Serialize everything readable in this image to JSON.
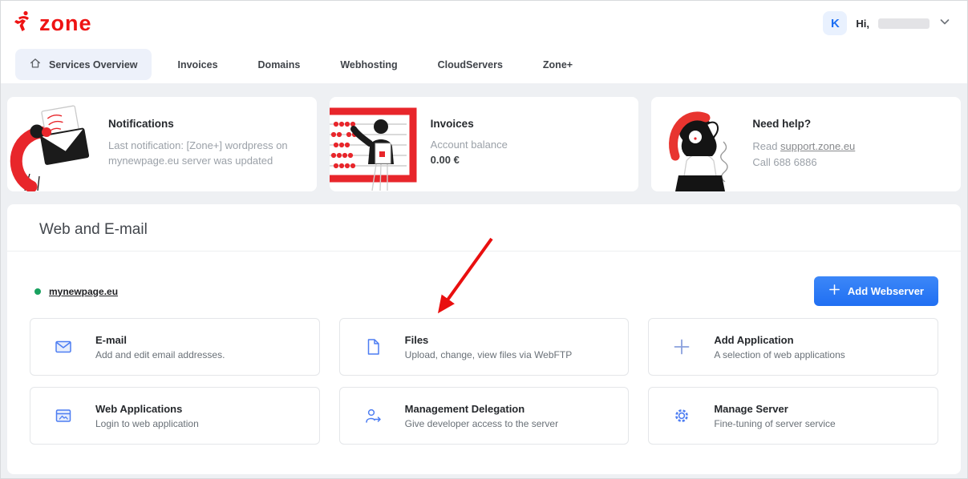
{
  "colors": {
    "brand_red": "#ee1313",
    "accent_blue": "#2374f2",
    "icon_blue": "#4d7df2",
    "status_green": "#18a15f",
    "arrow_red": "#e90f0f"
  },
  "header": {
    "logo_text": "zone",
    "user": {
      "avatar_initial": "K",
      "greeting": "Hi,"
    }
  },
  "nav": {
    "items": [
      {
        "label": "Services Overview",
        "active": true
      },
      {
        "label": "Invoices"
      },
      {
        "label": "Domains"
      },
      {
        "label": "Webhosting"
      },
      {
        "label": "CloudServers"
      },
      {
        "label": "Zone+"
      }
    ]
  },
  "info_cards": {
    "notifications": {
      "title": "Notifications",
      "desc": "Last notification: [Zone+] wordpress on mynewpage.eu server was updated"
    },
    "invoices": {
      "title": "Invoices",
      "balance_label": "Account balance",
      "balance_value": "0.00 €"
    },
    "help": {
      "title": "Need help?",
      "read_prefix": "Read ",
      "read_link": "support.zone.eu",
      "call_text": "Call 688 6886"
    }
  },
  "section": {
    "title": "Web and E-mail",
    "server": {
      "name": "mynewpage.eu"
    },
    "add_button_label": "Add Webserver",
    "cards": [
      {
        "icon": "email-icon",
        "title": "E-mail",
        "desc": "Add and edit email addresses."
      },
      {
        "icon": "file-icon",
        "title": "Files",
        "desc": "Upload, change, view files via WebFTP"
      },
      {
        "icon": "plus-icon",
        "title": "Add Application",
        "desc": "A selection of web applications"
      },
      {
        "icon": "web-applications-icon",
        "title": "Web Applications",
        "desc": "Login to web application"
      },
      {
        "icon": "delegation-icon",
        "title": "Management Delegation",
        "desc": "Give developer access to the server"
      },
      {
        "icon": "gear-icon",
        "title": "Manage Server",
        "desc": "Fine-tuning of server service"
      }
    ]
  }
}
